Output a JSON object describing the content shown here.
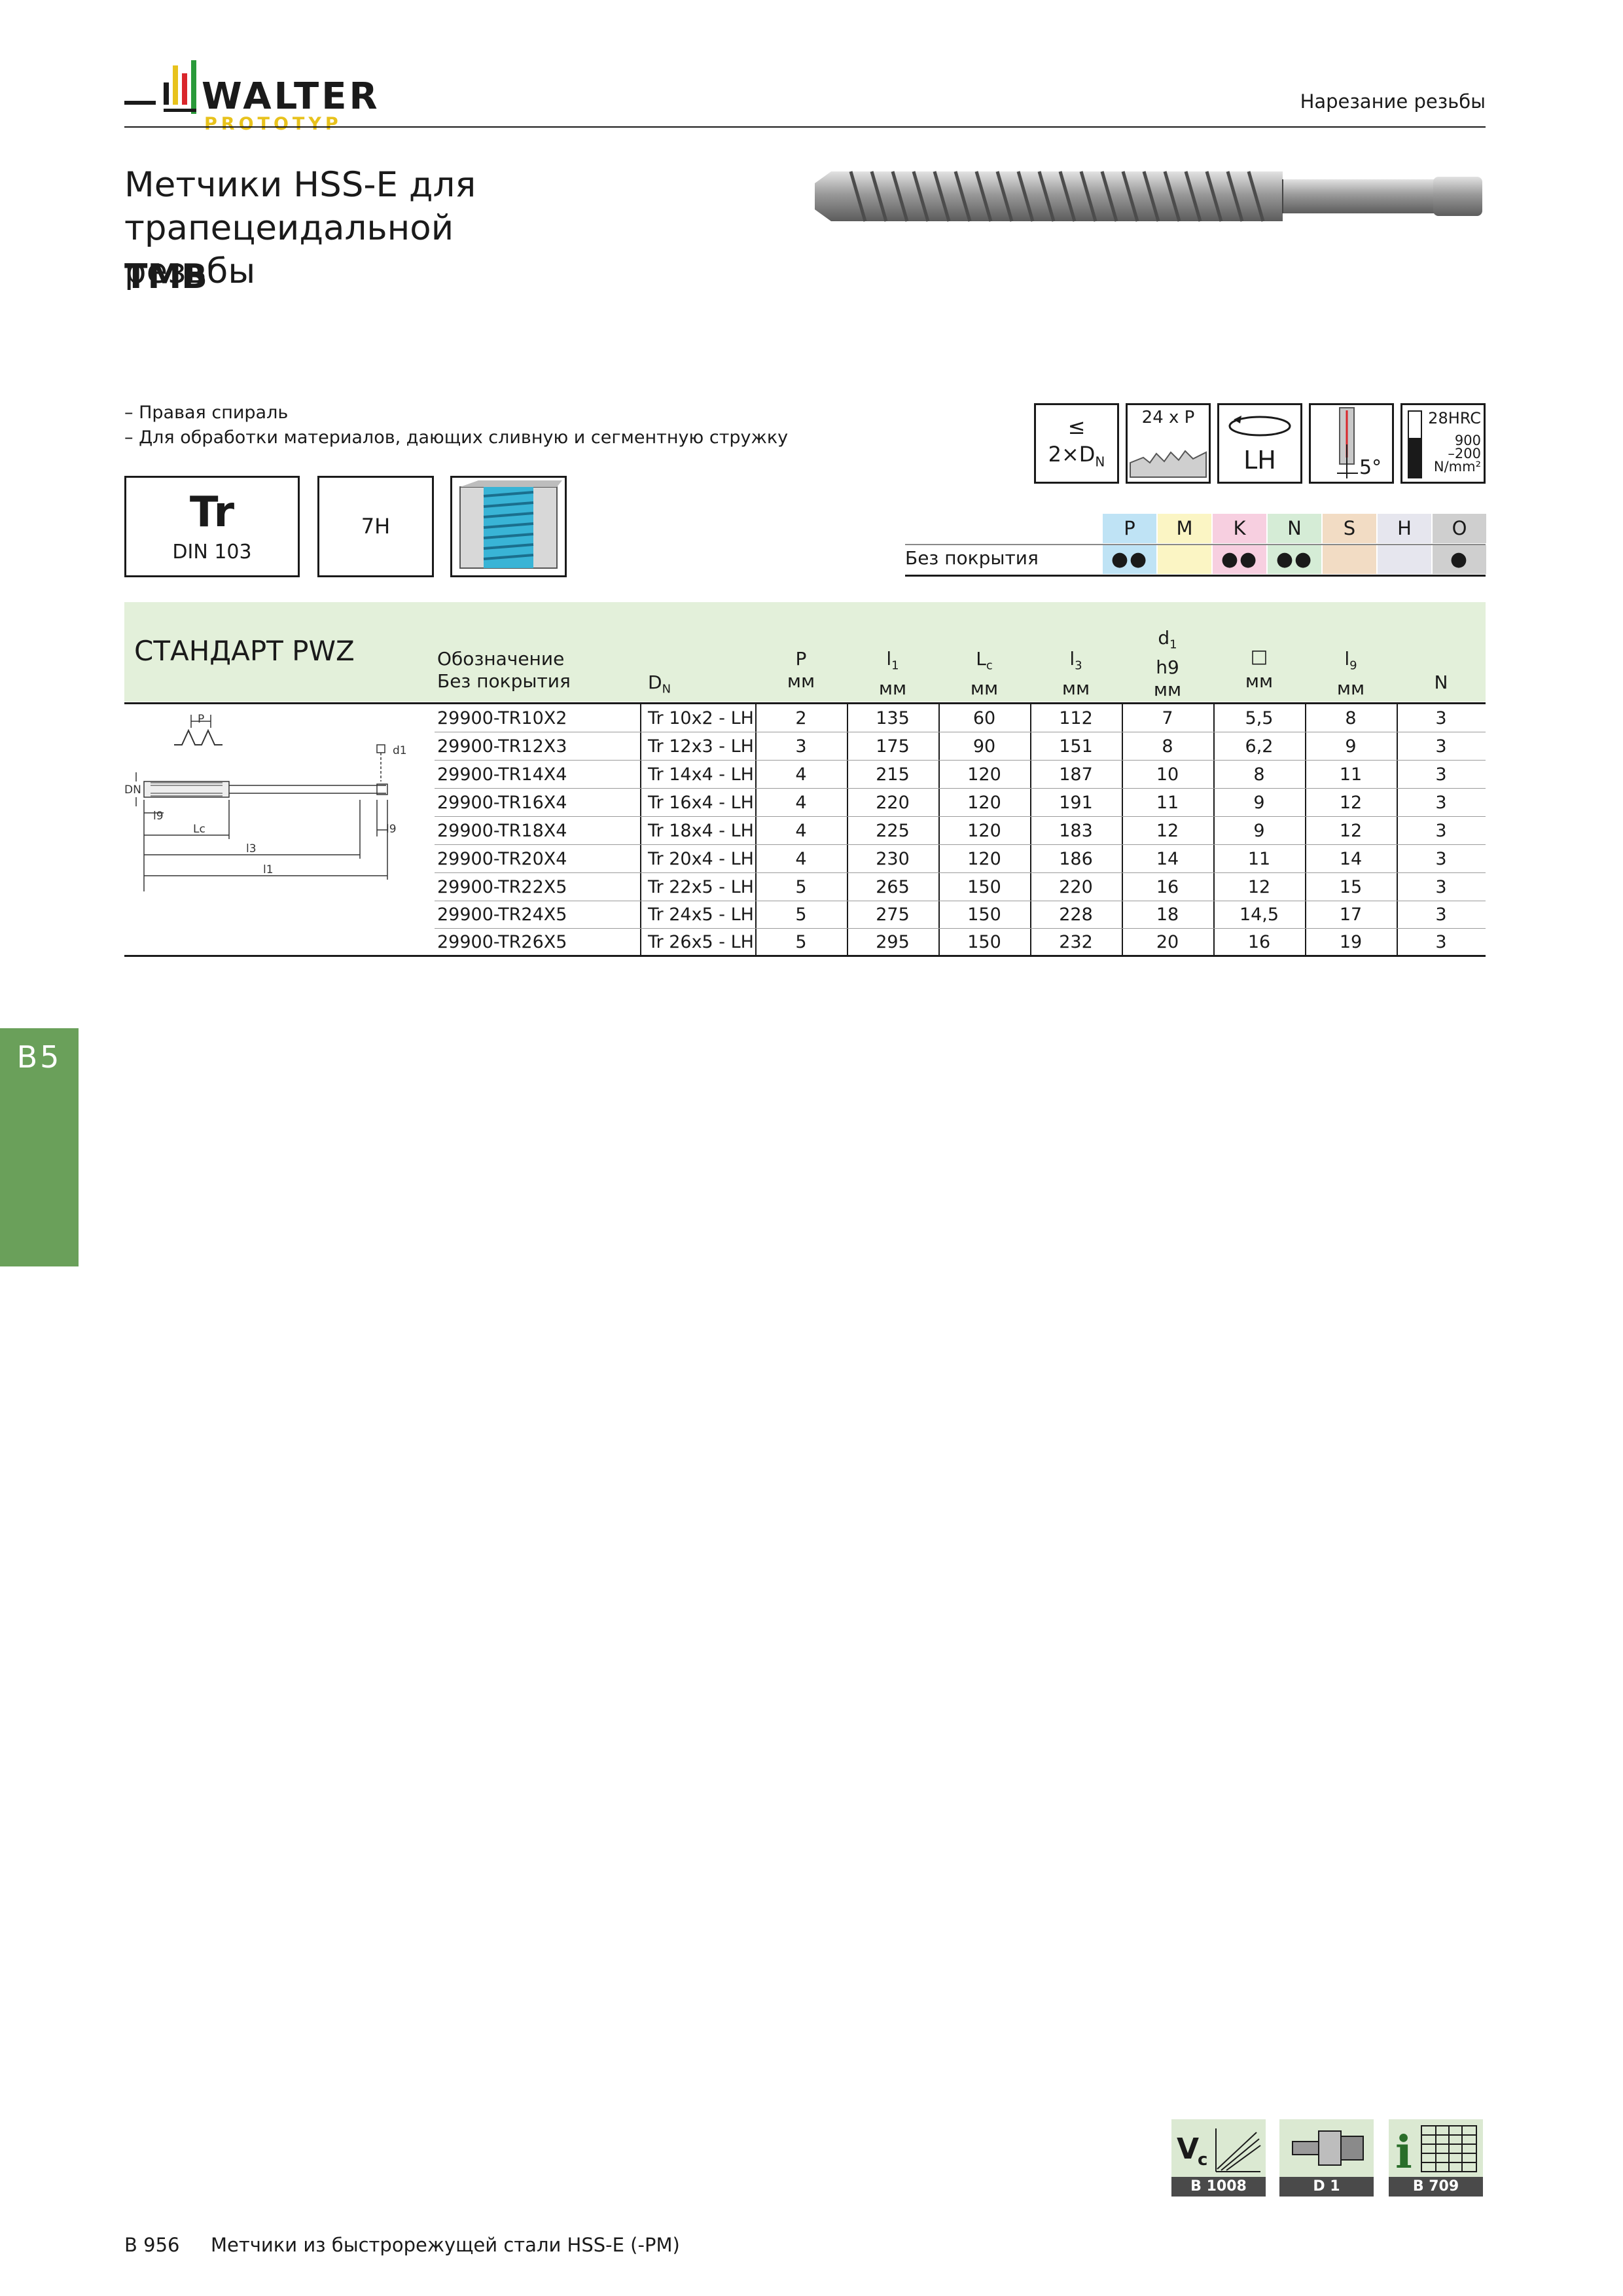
{
  "header": {
    "brand": "WALTER",
    "brand_sub": "PROTOTYP",
    "section": "Нарезание резьбы"
  },
  "title": {
    "line1": "Метчики HSS-E для трапецеидальной",
    "line2": "резьбы",
    "code": "TMB"
  },
  "features": [
    "– Правая спираль",
    "– Для обработки материалов, дающих сливную и сегментную стружку"
  ],
  "spec_boxes": {
    "thread": "Tr",
    "standard": "DIN 103",
    "tolerance": "7H"
  },
  "icons": {
    "depth_top": "≤",
    "depth_bottom": "2×D",
    "depth_sub": "N",
    "chamfer": "24 x P",
    "direction": "LH",
    "angle": "5°",
    "hardness": "28HRC",
    "strength_1": "900",
    "strength_2": "–200",
    "strength_unit": "N/mm²"
  },
  "materials": {
    "row_label": "Без покрытия",
    "groups": [
      {
        "code": "P",
        "color": "#bfe3f5",
        "value": "●●"
      },
      {
        "code": "M",
        "color": "#fbf5c4",
        "value": ""
      },
      {
        "code": "K",
        "color": "#f7cfe0",
        "value": "●●"
      },
      {
        "code": "N",
        "color": "#d5ecd6",
        "value": "●●"
      },
      {
        "code": "S",
        "color": "#f2dcc4",
        "value": ""
      },
      {
        "code": "H",
        "color": "#e6e6ee",
        "value": ""
      },
      {
        "code": "O",
        "color": "#cfcfcf",
        "value": "●"
      }
    ]
  },
  "table": {
    "section": "СТАНДАРТ PWZ",
    "col_designation_1": "Обозначение",
    "col_designation_2": "Без покрытия",
    "col_dn": "D",
    "col_dn_sub": "N",
    "col_p": "P",
    "col_l1": "l",
    "col_l1_sub": "1",
    "col_lc": "L",
    "col_lc_sub": "c",
    "col_l3": "l",
    "col_l3_sub": "3",
    "col_d1": "d",
    "col_d1_sub": "1",
    "col_d1_tol": "h9",
    "col_sq": "□",
    "col_l9": "l",
    "col_l9_sub": "9",
    "col_n": "N",
    "unit": "мм",
    "rows": [
      [
        "29900-TR10X2",
        "Tr 10x2 - LH",
        "2",
        "135",
        "60",
        "112",
        "7",
        "5,5",
        "8",
        "3"
      ],
      [
        "29900-TR12X3",
        "Tr 12x3 - LH",
        "3",
        "175",
        "90",
        "151",
        "8",
        "6,2",
        "9",
        "3"
      ],
      [
        "29900-TR14X4",
        "Tr 14x4 - LH",
        "4",
        "215",
        "120",
        "187",
        "10",
        "8",
        "11",
        "3"
      ],
      [
        "29900-TR16X4",
        "Tr 16x4 - LH",
        "4",
        "220",
        "120",
        "191",
        "11",
        "9",
        "12",
        "3"
      ],
      [
        "29900-TR18X4",
        "Tr 18x4 - LH",
        "4",
        "225",
        "120",
        "183",
        "12",
        "9",
        "12",
        "3"
      ],
      [
        "29900-TR20X4",
        "Tr 20x4 - LH",
        "4",
        "230",
        "120",
        "186",
        "14",
        "11",
        "14",
        "3"
      ],
      [
        "29900-TR22X5",
        "Tr 22x5 - LH",
        "5",
        "265",
        "150",
        "220",
        "16",
        "12",
        "15",
        "3"
      ],
      [
        "29900-TR24X5",
        "Tr 24x5 - LH",
        "5",
        "275",
        "150",
        "228",
        "18",
        "14,5",
        "17",
        "3"
      ],
      [
        "29900-TR26X5",
        "Tr 26x5 - LH",
        "5",
        "295",
        "150",
        "232",
        "20",
        "16",
        "19",
        "3"
      ]
    ]
  },
  "drawing_labels": {
    "p": "P",
    "d1": "d1",
    "dn": "DN",
    "l9a": "l9",
    "lc": "Lc",
    "l3": "l3",
    "l1": "l1",
    "l9b": "l9"
  },
  "side_tab": "B5",
  "refs": [
    {
      "label": "B 1008",
      "icon": "cutting-speed-icon"
    },
    {
      "label": "D 1",
      "icon": "tool-holder-icon"
    },
    {
      "label": "B 709",
      "icon": "info-table-icon"
    }
  ],
  "footer": {
    "page": "B 956",
    "text": "Метчики из быстрорежущей стали HSS-E (-PM)"
  }
}
